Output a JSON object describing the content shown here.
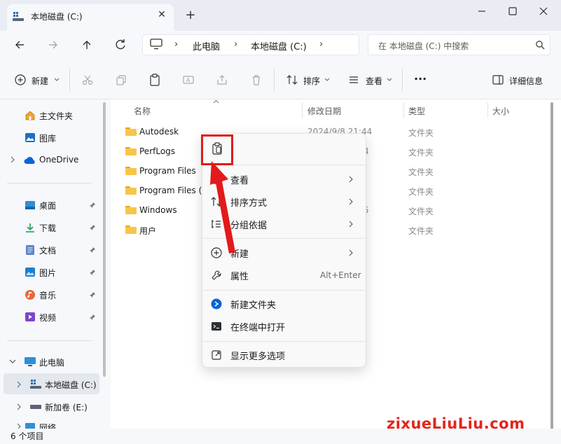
{
  "window": {
    "tab_title": "本地磁盘 (C:)",
    "tab_close": "✕",
    "tab_new": "+"
  },
  "address": {
    "crumbs": [
      "此电脑",
      "本地磁盘 (C:)"
    ],
    "sep": "›",
    "search_placeholder": "在 本地磁盘 (C:) 中搜索"
  },
  "toolbar": {
    "new_label": "新建",
    "sort_label": "排序",
    "view_label": "查看",
    "more_label": "···",
    "details_label": "详细信息"
  },
  "nav": {
    "home": "主文件夹",
    "gallery": "图库",
    "onedrive": "OneDrive",
    "quick": [
      "桌面",
      "下载",
      "文档",
      "图片",
      "音乐",
      "视频"
    ],
    "this_pc": "此电脑",
    "drive_c": "本地磁盘 (C:)",
    "drive_e": "新加卷 (E:)",
    "network": "网络"
  },
  "columns": {
    "name": "名称",
    "date": "修改日期",
    "type": "类型",
    "size": "大小"
  },
  "files": [
    {
      "name": "Autodesk",
      "date": "2024/9/8 21:44",
      "type": "文件夹"
    },
    {
      "name": "PerfLogs",
      "date": "4",
      "type": "文件夹"
    },
    {
      "name": "Program Files",
      "date": "",
      "type": "文件夹"
    },
    {
      "name": "Program Files (",
      "date": "",
      "type": "文件夹"
    },
    {
      "name": "Windows",
      "date": "5",
      "type": "文件夹"
    },
    {
      "name": "用户",
      "date": "",
      "type": "文件夹"
    }
  ],
  "context_menu": {
    "view": "查看",
    "sort": "排序方式",
    "group": "分组依据",
    "new": "新建",
    "properties": "属性",
    "properties_shortcut": "Alt+Enter",
    "new_folder": "新建文件夹",
    "open_terminal": "在终端中打开",
    "more_options": "显示更多选项"
  },
  "status": {
    "count": "6 个项目"
  },
  "watermark": {
    "brand": "zixueLiuLiu.com"
  },
  "colors": {
    "accent": "#0067c0",
    "highlight": "#e21a1a",
    "folder": "#f8c54a"
  }
}
